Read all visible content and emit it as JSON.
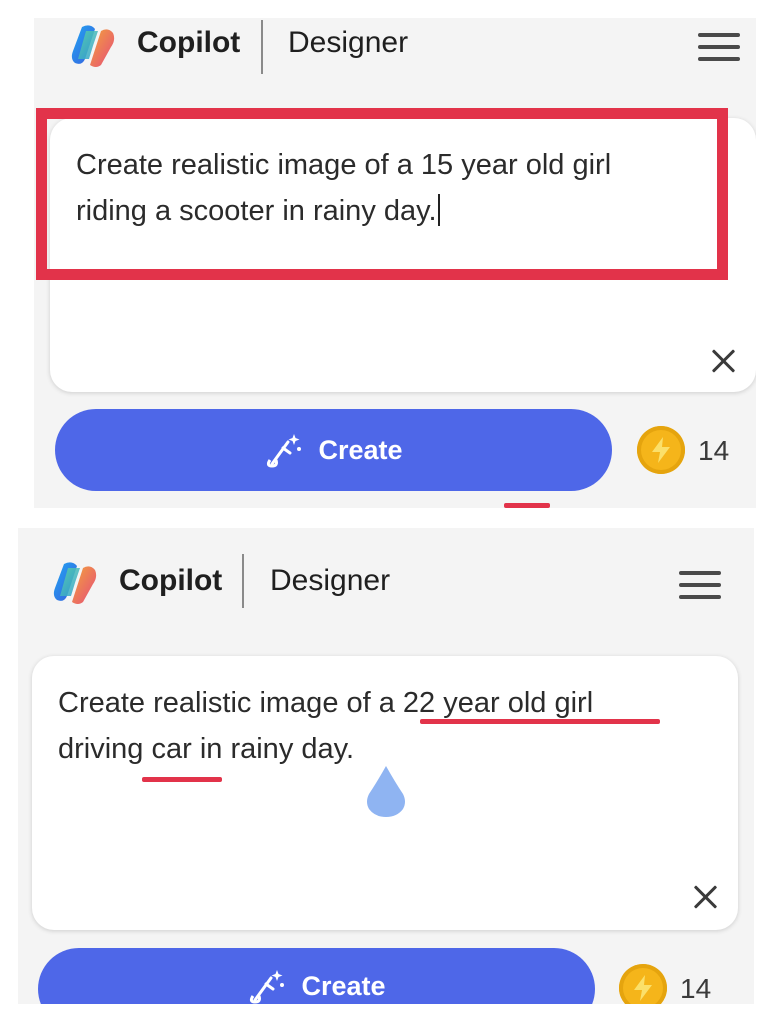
{
  "screens": [
    {
      "header": {
        "app_name": "Copilot",
        "section": "Designer"
      },
      "prompt": {
        "line1": "Create realistic image of a 15 year old girl",
        "line2": "riding a scooter in rainy day."
      },
      "create_label": "Create",
      "boost_count": "14"
    },
    {
      "header": {
        "app_name": "Copilot",
        "section": "Designer"
      },
      "prompt": {
        "line1": "Create realistic image of a 22 year old girl",
        "line2": "driving car in rainy day."
      },
      "create_label": "Create",
      "boost_count": "14"
    }
  ],
  "colors": {
    "accent_blue": "#4e67e8",
    "highlight_red": "#e2334a",
    "coin_gold": "#f5b51a"
  },
  "icons": [
    "copilot-logo-icon",
    "hamburger-menu-icon",
    "close-icon",
    "magic-wand-icon",
    "lightning-coin-icon",
    "touch-indicator-icon"
  ]
}
